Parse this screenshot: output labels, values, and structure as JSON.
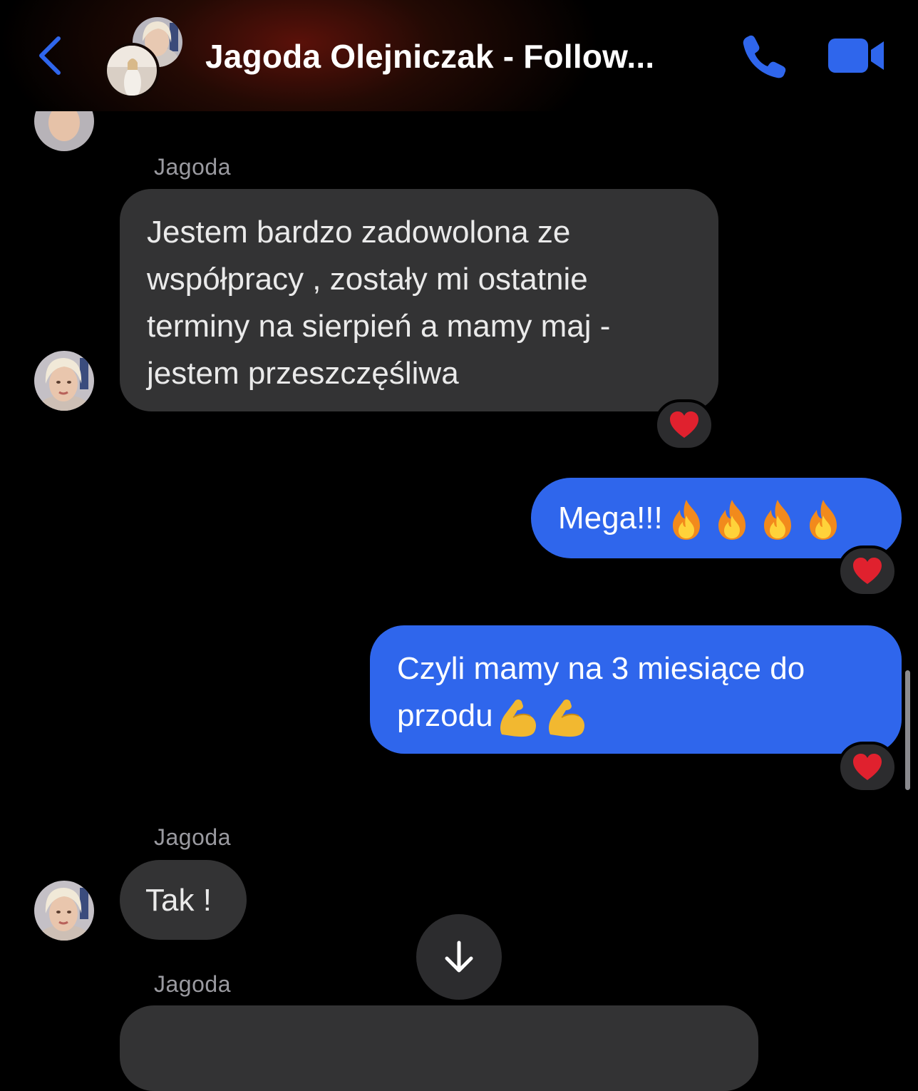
{
  "header": {
    "title": "Jagoda Olejniczak - Follow...",
    "back_icon": "chevron-left-icon",
    "call_icon": "phone-icon",
    "video_icon": "video-camera-icon",
    "accent_color": "#2f66ec"
  },
  "messages": [
    {
      "sender": "Jagoda",
      "direction": "incoming",
      "text": "Jestem bardzo zadowolona ze współpracy , zostały mi ostatnie terminy na sierpień a mamy maj - jestem przeszczęśliwa",
      "reaction": "❤️"
    },
    {
      "direction": "outgoing",
      "text": "Mega!!!",
      "emojis": [
        "fire-icon",
        "fire-icon",
        "fire-icon",
        "fire-icon"
      ],
      "reaction": "❤️"
    },
    {
      "direction": "outgoing",
      "text": "Czyli mamy na 3 miesiące do przodu",
      "emojis": [
        "flexed-biceps-icon",
        "flexed-biceps-icon"
      ],
      "reaction": "❤️"
    },
    {
      "sender": "Jagoda",
      "direction": "incoming",
      "text": "Tak !"
    },
    {
      "sender": "Jagoda",
      "direction": "incoming",
      "text": ""
    }
  ],
  "colors": {
    "incoming_bubble": "#333334",
    "outgoing_bubble": "#2f66ec",
    "sender_label": "#9a9aa0",
    "reaction_heart": "#e0212e"
  },
  "controls": {
    "scroll_down_icon": "arrow-down-icon"
  }
}
